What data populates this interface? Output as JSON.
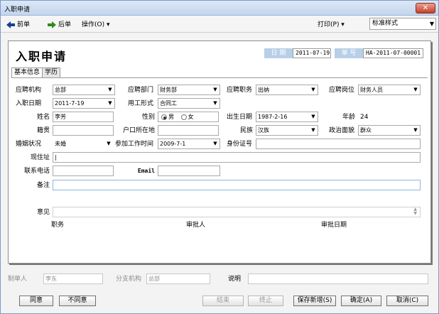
{
  "window": {
    "title": "入职申请"
  },
  "toolbar": {
    "prev": "前单",
    "next": "后单",
    "operate": "操作(O) ▾",
    "print": "打印(P) ▾",
    "print_style": "标准样式"
  },
  "header": {
    "title": "入职申请",
    "date_label": "日 期",
    "date_value": "2011-07-19",
    "no_label": "单 号",
    "no_value": "HA-2011-07-00001"
  },
  "tabs": [
    "基本信息",
    "学历"
  ],
  "form": {
    "org_label": "应聘机构",
    "org_value": "总部",
    "dept_label": "应聘部门",
    "dept_value": "财务部",
    "duty_label": "应聘职务",
    "duty_value": "出纳",
    "post_label": "应聘岗位",
    "post_value": "财务人员",
    "entry_date_label": "入职日期",
    "entry_date_value": "2011-7-19",
    "employ_label": "用工形式",
    "employ_value": "合同工",
    "name_label": "姓名",
    "name_value": "李芳",
    "gender_label": "性别",
    "gender_male": "男",
    "gender_female": "女",
    "birth_label": "出生日期",
    "birth_value": "1987-2-16",
    "age_label": "年龄",
    "age_value": "24",
    "native_label": "籍贯",
    "native_value": "",
    "hukou_label": "户口所在地",
    "hukou_value": "",
    "nation_label": "民族",
    "nation_value": "汉族",
    "political_label": "政治面貌",
    "political_value": "群众",
    "marital_label": "婚姻状况",
    "marital_value": "未婚",
    "work_time_label": "参加工作时间",
    "work_time_value": "2009-7-1",
    "id_label": "身份证号",
    "id_value": "",
    "address_label": "现住址",
    "address_value": "",
    "phone_label": "联系电话",
    "phone_value": "",
    "email_label": "Email",
    "email_value": "",
    "remark_label": "备注",
    "remark_value": ""
  },
  "opinion": {
    "label": "意见",
    "duty_col": "职务",
    "approver_col": "审批人",
    "date_col": "审批日期"
  },
  "footer": {
    "maker_label": "制单人",
    "maker_value": "李东",
    "branch_label": "分支机构",
    "branch_value": "总部",
    "note_label": "说明",
    "note_value": ""
  },
  "buttons": {
    "agree": "同意",
    "disagree": "不同意",
    "end": "结束",
    "stop": "终止",
    "save_new": "保存新增(S)",
    "ok": "确定(A)",
    "cancel": "取消(C)"
  },
  "colors": {
    "header_label_bg": "#b8cfe8",
    "title_bar": "#c3d6ee",
    "close": "#c6402a"
  }
}
